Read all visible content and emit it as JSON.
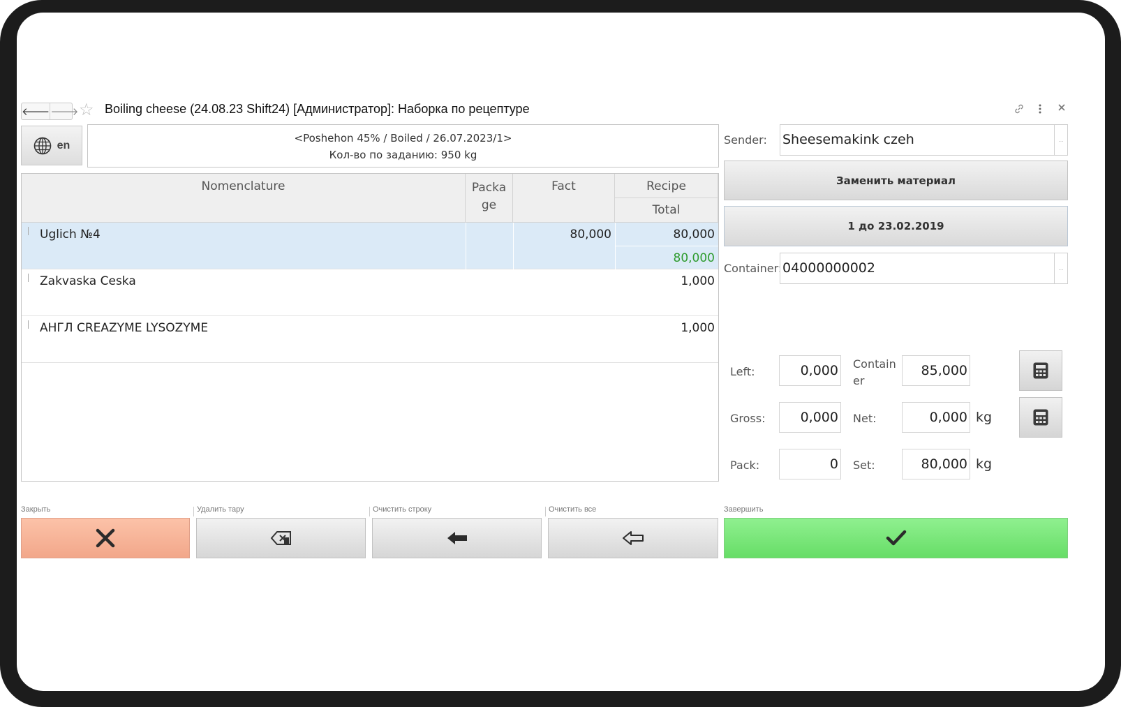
{
  "window": {
    "title": "Boiling cheese (24.08.23 Shift24) [Администратор]: Наборка по рецептуре",
    "nav_back_icon": "arrow-left-icon",
    "nav_forward_icon": "arrow-right-icon",
    "favorite_icon": "star-icon",
    "link_icon": "link-icon",
    "more_icon": "more-vertical-icon",
    "close_icon": "close-icon"
  },
  "language": {
    "label": "en",
    "icon": "globe-icon"
  },
  "header": {
    "line1": "<Poshehon 45% / Boiled / 26.07.2023/1>",
    "line2": "Кол-во по заданию: 950 kg"
  },
  "table": {
    "columns": {
      "nomenclature": "Nomenclature",
      "package": "Packa ge",
      "fact": "Fact",
      "recipe": "Recipe",
      "total": "Total"
    },
    "rows": [
      {
        "name": "Uglich №4",
        "package": "",
        "fact": "80,000",
        "recipe": "80,000",
        "total": "80,000",
        "selected": true
      },
      {
        "name": "Zakvaska Ceska",
        "package": "",
        "fact": "",
        "recipe": "1,000",
        "total": "",
        "selected": false
      },
      {
        "name": "АНГЛ CREAZYME LYSOZYME",
        "package": "",
        "fact": "",
        "recipe": "1,000",
        "total": "",
        "selected": false
      }
    ]
  },
  "sender": {
    "label": "Sender:",
    "value": "Sheesemakink czeh",
    "picker": "..."
  },
  "replace_button": {
    "label": "Заменить материал"
  },
  "batch_button": {
    "label": "1 до 23.02.2019"
  },
  "container": {
    "label": "Container:",
    "value": "04000000002",
    "picker": "..."
  },
  "weights": {
    "left_label": "Left:",
    "left_value": "0,000",
    "container_label": "Contain er",
    "container_value": "85,000",
    "gross_label": "Gross:",
    "gross_value": "0,000",
    "net_label": "Net:",
    "net_value": "0,000",
    "net_unit": "kg",
    "pack_label": "Pack:",
    "pack_value": "0",
    "set_label": "Set:",
    "set_value": "80,000",
    "set_unit": "kg",
    "calc_icon": "calculator-icon"
  },
  "actions": {
    "close": {
      "caption": "Закрыть",
      "icon": "x-icon",
      "color": "#f5ae92"
    },
    "delete_tare": {
      "caption": "Удалить тару",
      "icon": "backspace-icon"
    },
    "clear_row": {
      "caption": "Очистить строку",
      "icon": "arrow-left-filled-icon"
    },
    "clear_all": {
      "caption": "Очистить все",
      "icon": "arrow-left-outline-icon"
    },
    "finish": {
      "caption": "Завершить",
      "icon": "check-icon",
      "color": "#78e478"
    }
  },
  "colors": {
    "selected_row": "#dbeaf7",
    "total_green": "#2e9b2e"
  }
}
